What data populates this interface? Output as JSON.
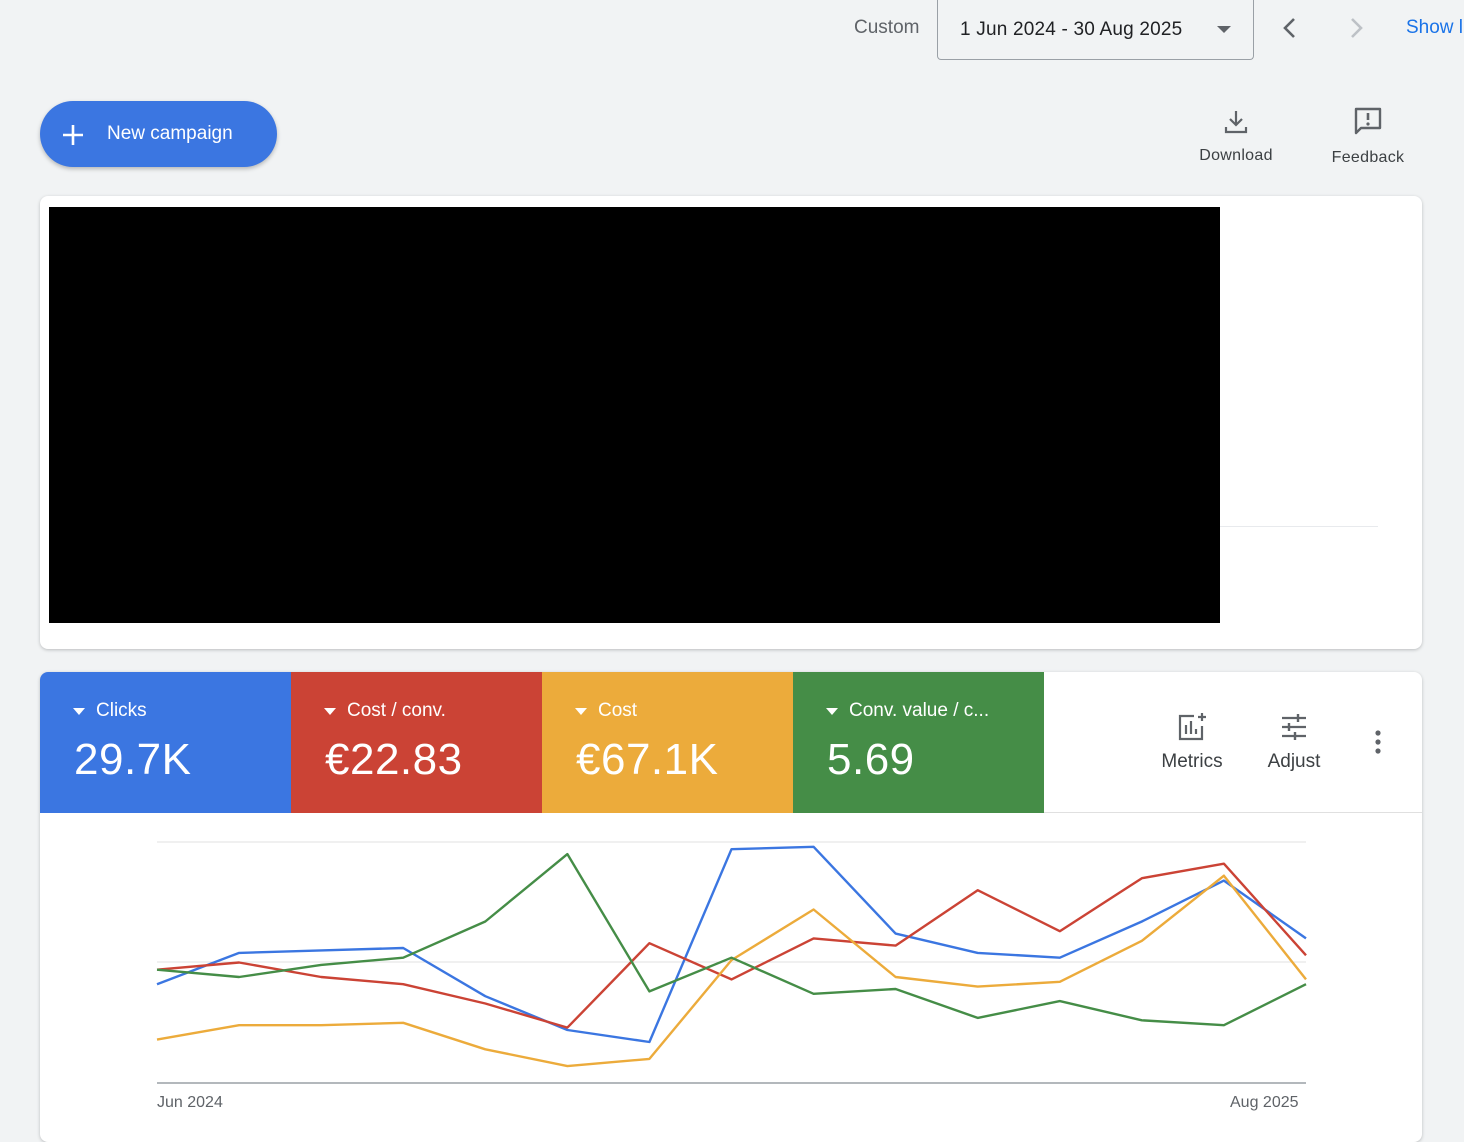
{
  "topbar": {
    "range_type": "Custom",
    "date_range": "1 Jun 2024 - 30 Aug 2025",
    "show_link": "Show l"
  },
  "actions": {
    "new_campaign": "New campaign",
    "download": "Download",
    "feedback": "Feedback"
  },
  "metrics": [
    {
      "name": "Clicks",
      "value": "29.7K",
      "color": "#3b76e1"
    },
    {
      "name": "Cost / conv.",
      "value": "€22.83",
      "color": "#cb4335"
    },
    {
      "name": "Cost",
      "value": "€67.1K",
      "color": "#ecab3b"
    },
    {
      "name": "Conv. value / c...",
      "value": "5.69",
      "color": "#458d47"
    }
  ],
  "metric_tools": {
    "metrics": "Metrics",
    "adjust": "Adjust"
  },
  "chart_data": {
    "type": "line",
    "x_labels": [
      "Jun 2024",
      "Aug 2025"
    ],
    "y_scale": [
      0,
      100
    ],
    "grid": true,
    "series": [
      {
        "name": "Clicks",
        "color": "#3b76e1",
        "values": [
          41,
          54,
          55,
          56,
          36,
          22,
          17,
          97,
          98,
          62,
          54,
          52,
          67,
          84,
          60
        ]
      },
      {
        "name": "Cost / conv.",
        "color": "#cb4335",
        "values": [
          47,
          50,
          44,
          41,
          33,
          23,
          58,
          43,
          60,
          57,
          80,
          63,
          85,
          91,
          53
        ]
      },
      {
        "name": "Cost",
        "color": "#ecab3b",
        "values": [
          18,
          24,
          24,
          25,
          14,
          7,
          10,
          51,
          72,
          44,
          40,
          42,
          59,
          86,
          43
        ]
      },
      {
        "name": "Conv. value / c...",
        "color": "#458d47",
        "values": [
          47,
          44,
          49,
          52,
          67,
          95,
          38,
          52,
          37,
          39,
          27,
          34,
          26,
          24,
          41
        ]
      }
    ]
  }
}
